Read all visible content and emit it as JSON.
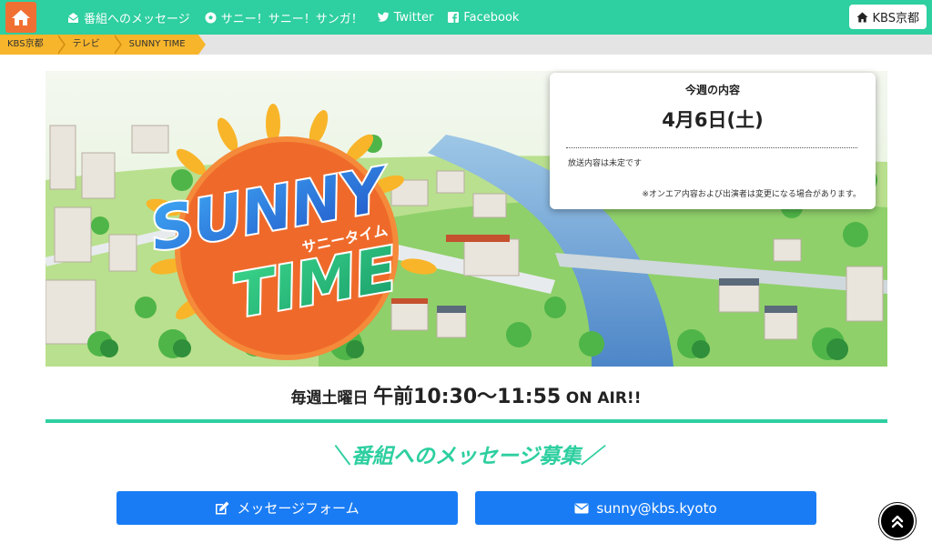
{
  "nav": {
    "links": [
      {
        "label": "番組へのメッセージ",
        "icon": "envelope-open-icon"
      },
      {
        "label": "サニー！サニー！サンガ！",
        "icon": "soccer-ball-icon"
      },
      {
        "label": "Twitter",
        "icon": "twitter-icon"
      },
      {
        "label": "Facebook",
        "icon": "facebook-icon"
      }
    ],
    "station_button": "KBS京都"
  },
  "breadcrumb": [
    "KBS京都",
    "テレビ",
    "SUNNY TIME"
  ],
  "hero": {
    "logo_line1": "SUNNY",
    "logo_line2": "TIME",
    "logo_kana": "サニータイム"
  },
  "info": {
    "heading": "今週の内容",
    "date": "4月6日(土)",
    "body": "放送内容は未定です",
    "note": "※オンエア内容および出演者は変更になる場合があります。"
  },
  "airtime": {
    "days": "毎週土曜日",
    "time": "午前10:30～11:55",
    "suffix": "ON AIR!!"
  },
  "message_section": {
    "title": "＼番組へのメッセージ募集／",
    "form_button": "メッセージフォーム",
    "mail_button": "sunny@kbs.kyoto"
  },
  "colors": {
    "accent_green": "#2ecfa0",
    "home_orange": "#f07033",
    "crumb_yellow": "#f7b52b",
    "button_blue": "#1a7cf5"
  }
}
